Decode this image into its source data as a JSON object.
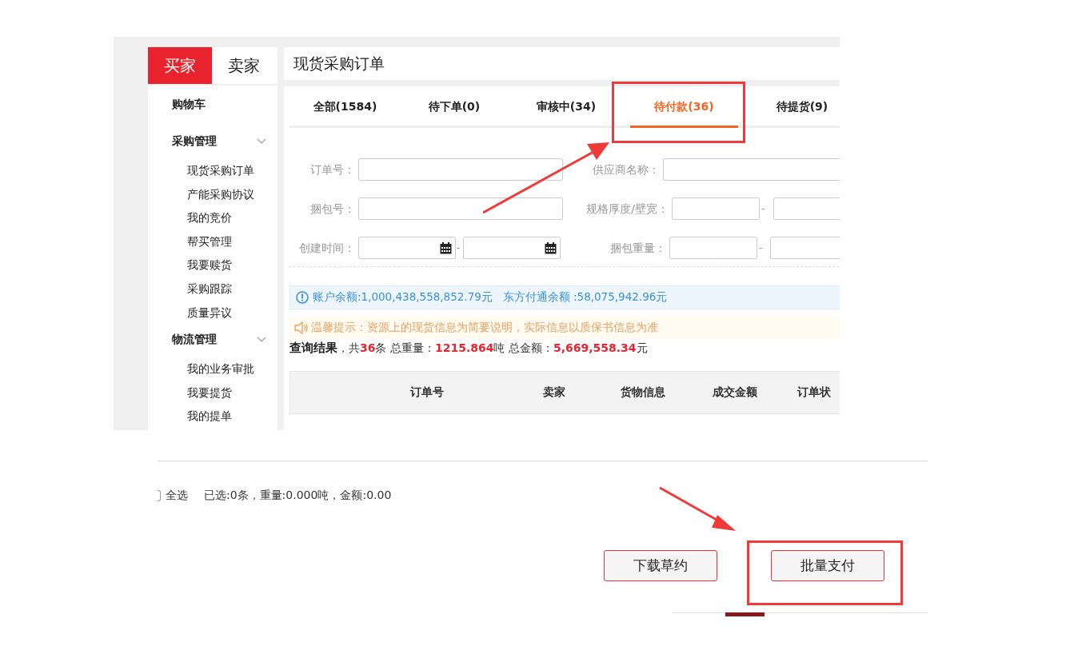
{
  "role_tabs": [
    {
      "label": "买家",
      "selected": true
    },
    {
      "label": "卖家",
      "selected": false
    }
  ],
  "sidebar": {
    "items": [
      {
        "label": "购物车",
        "kind": "link"
      },
      {
        "label": "采购管理",
        "kind": "group",
        "expanded": true,
        "children": [
          {
            "label": "现货采购订单"
          },
          {
            "label": "产能采购协议"
          },
          {
            "label": "我的竞价"
          },
          {
            "label": "帮买管理"
          },
          {
            "label": "我要赎货"
          },
          {
            "label": "采购跟踪"
          },
          {
            "label": "质量异议"
          }
        ]
      },
      {
        "label": "物流管理",
        "kind": "group",
        "expanded": true,
        "children": [
          {
            "label": "我的业务审批"
          },
          {
            "label": "我要提货"
          },
          {
            "label": "我的提单"
          }
        ]
      }
    ]
  },
  "page_title": "现货采购订单",
  "status_tabs": [
    {
      "label": "全部(1584)",
      "selected": false
    },
    {
      "label": "待下单(0)",
      "selected": false
    },
    {
      "label": "审核中(34)",
      "selected": false
    },
    {
      "label": "待付款(36)",
      "selected": true
    },
    {
      "label": "待提货(9)",
      "selected": false
    }
  ],
  "filters": [
    {
      "label": "订单号：",
      "kind": "text"
    },
    {
      "label": "供应商名称：",
      "kind": "text"
    },
    {
      "label": "捆包号：",
      "kind": "text"
    },
    {
      "label": "规格厚度/壁宽：",
      "kind": "range",
      "separator": "-"
    },
    {
      "label": "创建时间：",
      "kind": "date_range",
      "separator": "-"
    },
    {
      "label": "捆包重量：",
      "kind": "range",
      "separator": "-"
    }
  ],
  "balance_notice": "账户余额:1,000,438,558,852.79元   东方付通余额 :58,075,942.96元",
  "tip_notice": "温馨提示：资源上的现货信息为简要说明，实际信息以质保书信息为准",
  "summary": [
    {
      "text": "查询结果",
      "kind": "title"
    },
    {
      "text": "，共",
      "kind": "plain"
    },
    {
      "text": "36",
      "kind": "number"
    },
    {
      "text": "条 总重量：",
      "kind": "plain"
    },
    {
      "text": "1215.864",
      "kind": "number"
    },
    {
      "text": "吨 总金额：",
      "kind": "plain"
    },
    {
      "text": "5,669,558.34",
      "kind": "number"
    },
    {
      "text": "元",
      "kind": "plain"
    }
  ],
  "table": {
    "columns": [
      "订单号",
      "卖家",
      "货物信息",
      "成交金额",
      "订单状"
    ]
  },
  "footer": {
    "select_all": "全选",
    "selection": "已选:0条，重量:0.000吨，金额:0.00",
    "buttons": [
      "下载草约",
      "批量支付"
    ]
  }
}
